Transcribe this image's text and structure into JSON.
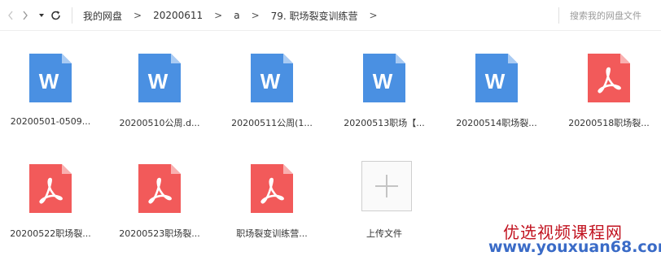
{
  "toolbar": {
    "back_icon": "chevron-left-icon",
    "forward_icon": "chevron-right-icon",
    "dropdown_icon": "caret-down-icon",
    "refresh_icon": "refresh-icon"
  },
  "breadcrumb": {
    "items": [
      "我的网盘",
      "20200611",
      "a",
      "79. 职场裂变训练营"
    ],
    "separator": ">"
  },
  "search": {
    "placeholder": "搜索我的网盘文件"
  },
  "files": [
    {
      "name": "20200501-0509...",
      "type": "word"
    },
    {
      "name": "20200510公周.d...",
      "type": "word"
    },
    {
      "name": "20200511公周(1...",
      "type": "word"
    },
    {
      "name": "20200513职场【...",
      "type": "word"
    },
    {
      "name": "20200514职场裂...",
      "type": "word"
    },
    {
      "name": "20200518职场裂...",
      "type": "pdf"
    },
    {
      "name": "20200522职场裂...",
      "type": "pdf"
    },
    {
      "name": "20200523职场裂...",
      "type": "pdf"
    },
    {
      "name": "职场裂变训练营...",
      "type": "pdf"
    }
  ],
  "upload": {
    "label": "上传文件",
    "icon": "plus-icon"
  },
  "watermark": {
    "line1": "优选视频课程网",
    "line2": "www.youxuan68.com"
  },
  "colors": {
    "word": "#4a90e2",
    "pdf": "#f25a5a"
  }
}
